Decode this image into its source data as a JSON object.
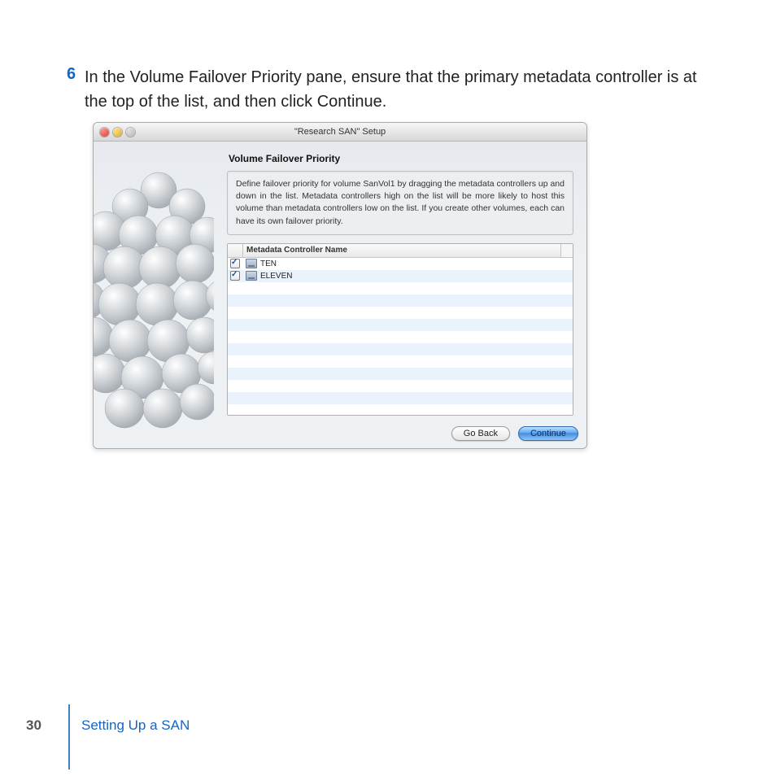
{
  "step": {
    "number": "6",
    "text": "In the Volume Failover Priority pane, ensure that the primary metadata controller is at the top of the list, and then click Continue."
  },
  "window": {
    "title": "\"Research SAN\" Setup",
    "pane_title": "Volume Failover Priority",
    "description": "Define failover priority for volume SanVol1 by dragging the metadata controllers up and down in the list. Metadata controllers high on the list will be more likely to host this volume than metadata controllers low on the list. If you create other volumes, each can have its own failover priority.",
    "column_header": "Metadata Controller Name",
    "rows": [
      {
        "checked": true,
        "name": "TEN"
      },
      {
        "checked": true,
        "name": "ELEVEN"
      }
    ],
    "buttons": {
      "back": "Go Back",
      "continue": "Continue"
    }
  },
  "footer": {
    "page": "30",
    "chapter": "Setting Up a SAN"
  }
}
